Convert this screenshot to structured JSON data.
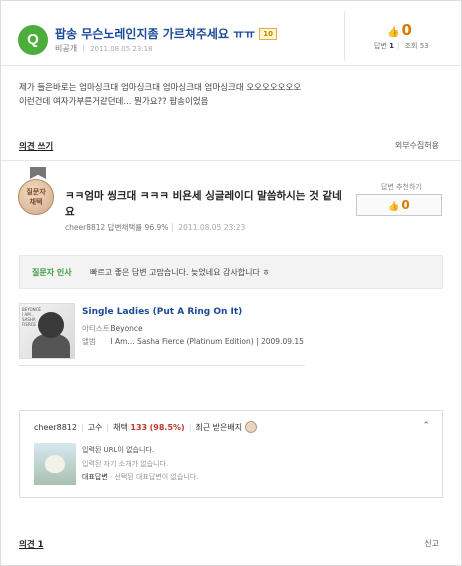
{
  "question": {
    "icon_letter": "Q",
    "title": "팝송 무슨노레인지좀 가르쳐주세요 ㅠㅠ",
    "bounty": "10",
    "author": "비공개",
    "date": "2011.08.05 23:18",
    "likes": "0",
    "answer_label": "답변",
    "answer_count": "1",
    "view_label": "조회",
    "view_count": "53",
    "body_line1": "제가 들은바로는 엄마싱크대 엄마싱크대 엄마싱크대 엄마싱크대 오오오오오오오",
    "body_line2": "이런건데 여자가부른거같던데... 뭔가요?? 팝송이었음",
    "opinion_link": "의견 쓰기",
    "no_scrap": "외부수집허용"
  },
  "answer": {
    "medal_line1": "질문자",
    "medal_line2": "채택",
    "title": "ㅋㅋ엄마 씽크대 ㅋㅋㅋ 비욘세 싱글레이디 말씀하시는 것 같네요",
    "author": "cheer8812",
    "adopt_rate": "답변채택률 96.9%",
    "date": "2011.08.05 23:23",
    "recommend_label": "답변 추천하기",
    "recommend_count": "0",
    "thanks_label": "질문자 인사",
    "thanks_msg": "빠르고 좋은 답변 고맙습니다. 늦었네요 감사합니다 ㅎ"
  },
  "music": {
    "album_text": "BEYONCÉ I AM... SASHA FIERCE",
    "title": "Single Ladies (Put A Ring On It)",
    "artist_label": "아티스트",
    "artist": "Beyonce",
    "album_label": "앨범",
    "album": "I Am... Sasha Fierce (Platinum Edition) | 2009.09.15"
  },
  "profile": {
    "user": "cheer8812",
    "grade": "고수",
    "adopt_label": "채택",
    "adopt_count": "133",
    "adopt_pct": "(98.5%)",
    "recent_badge": "최근 받은배지",
    "url_text": "입력된 URL이 없습니다.",
    "intro_text": "입력된 자기 소개가 없습니다.",
    "rep_label": "대표답변",
    "rep_text": "· 선택된 대표답변이 없습니다."
  },
  "footer": {
    "opinion_link": "의견 1",
    "report": "신고"
  }
}
